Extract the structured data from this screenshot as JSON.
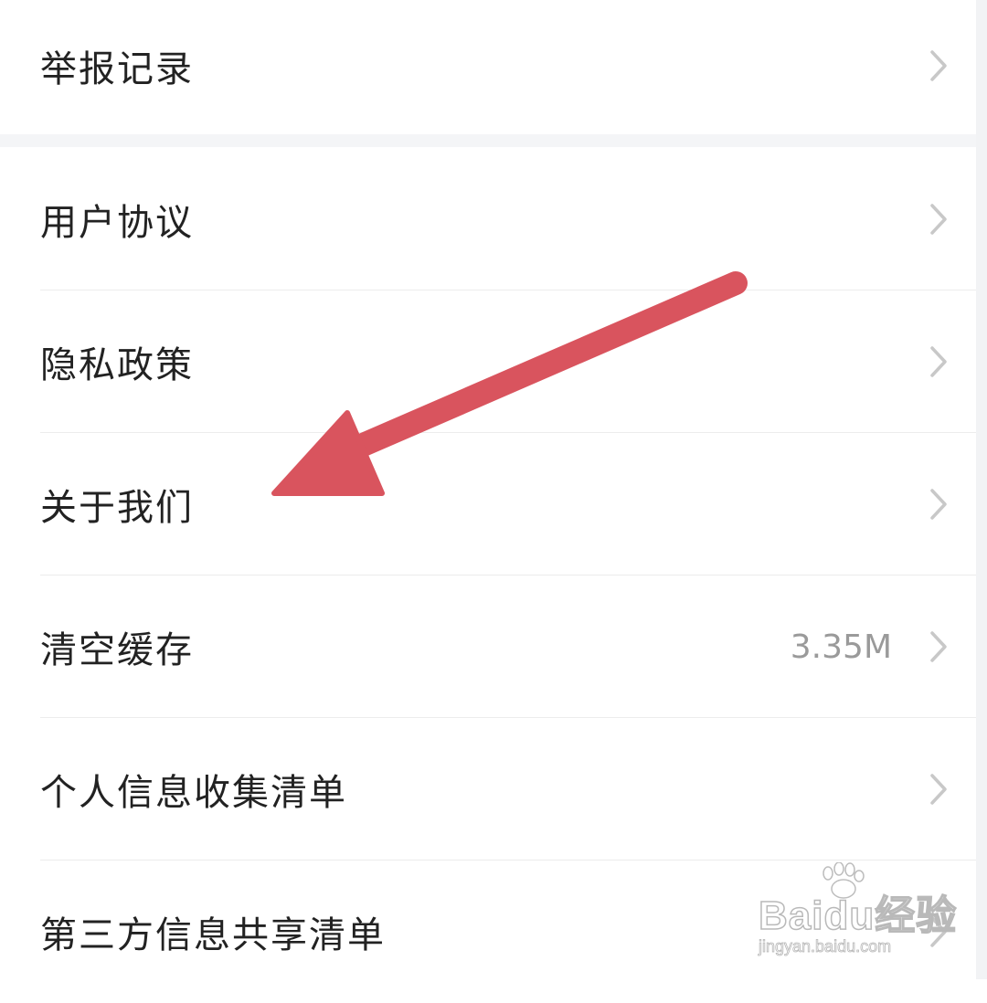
{
  "settings": {
    "items": [
      {
        "label": "举报记录",
        "value": ""
      },
      {
        "label": "用户协议",
        "value": ""
      },
      {
        "label": "隐私政策",
        "value": ""
      },
      {
        "label": "关于我们",
        "value": ""
      },
      {
        "label": "清空缓存",
        "value": "3.35M"
      },
      {
        "label": "个人信息收集清单",
        "value": ""
      },
      {
        "label": "第三方信息共享清单",
        "value": ""
      }
    ]
  },
  "annotation": {
    "arrow_color": "#d9545e"
  },
  "watermark": {
    "brand": "Baidu经验",
    "url": "jingyan.baidu.com"
  },
  "colors": {
    "text": "#222222",
    "value": "#9a9a9a",
    "chevron": "#c8c8c8",
    "divider": "#ececec",
    "group_gap": "#f4f5f7"
  },
  "icons": {
    "row_chevron": "chevron-right-icon",
    "watermark_logo": "paw-icon"
  }
}
